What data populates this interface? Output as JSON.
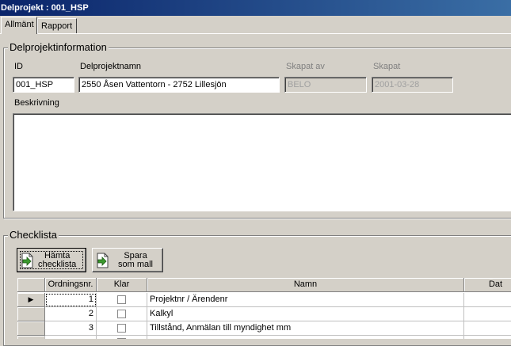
{
  "window": {
    "title_prefix": "Delprojekt :",
    "title_value": "001_HSP"
  },
  "tabs": [
    {
      "label": "Allmänt"
    },
    {
      "label": "Rapport"
    }
  ],
  "info": {
    "legend": "Delprojektinformation",
    "id_label": "ID",
    "id_value": "001_HSP",
    "name_label": "Delprojektnamn",
    "name_value": "2550 Åsen Vattentorn - 2752 Lillesjön",
    "created_by_label": "Skapat av",
    "created_by_value": "BELO",
    "created_label": "Skapat",
    "created_value": "2001-03-28",
    "description_label": "Beskrivning",
    "description_value": ""
  },
  "checklist": {
    "legend": "Checklista",
    "fetch_button": {
      "line1": "Hämta",
      "line2": "checklista",
      "icon": "document-arrow-icon"
    },
    "save_button": {
      "line1": "Spara",
      "line2": "som mall",
      "icon": "document-arrow-icon"
    },
    "columns": [
      "Ordningsnr.",
      "Klar",
      "Namn",
      "Dat"
    ],
    "rows": [
      {
        "order": "1",
        "done": false,
        "name": "Projektnr / Ärendenr",
        "date": ""
      },
      {
        "order": "2",
        "done": false,
        "name": "Kalkyl",
        "date": ""
      },
      {
        "order": "3",
        "done": false,
        "name": "Tillstånd, Anmälan till myndighet mm",
        "date": ""
      }
    ],
    "current_row_indicator": "▶"
  },
  "colors": {
    "title_bar": "#0a246a",
    "face": "#d4d0c8",
    "icon_green": "#3c9a2e"
  }
}
